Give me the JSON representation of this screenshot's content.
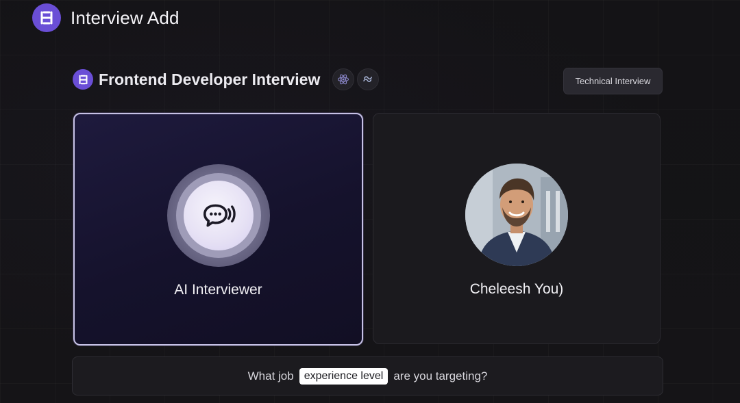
{
  "header": {
    "title": "Interview Add",
    "logo_icon": "brand-logo-icon"
  },
  "interview": {
    "title": "Frontend Developer Interview",
    "tech_icons": [
      "react-icon",
      "tailwind-icon"
    ],
    "type_badge": "Technical Interview"
  },
  "cards": {
    "ai": {
      "label": "AI Interviewer",
      "icon": "chat-voice-icon"
    },
    "user": {
      "label": "Cheleesh You)",
      "icon": "user-avatar"
    }
  },
  "prompt": {
    "before": "What job",
    "highlight": "experience level",
    "after": "are you targeting?"
  },
  "colors": {
    "accent": "#6a4ed6",
    "ai_card_border": "#c7c2e6",
    "background": "#151417"
  }
}
